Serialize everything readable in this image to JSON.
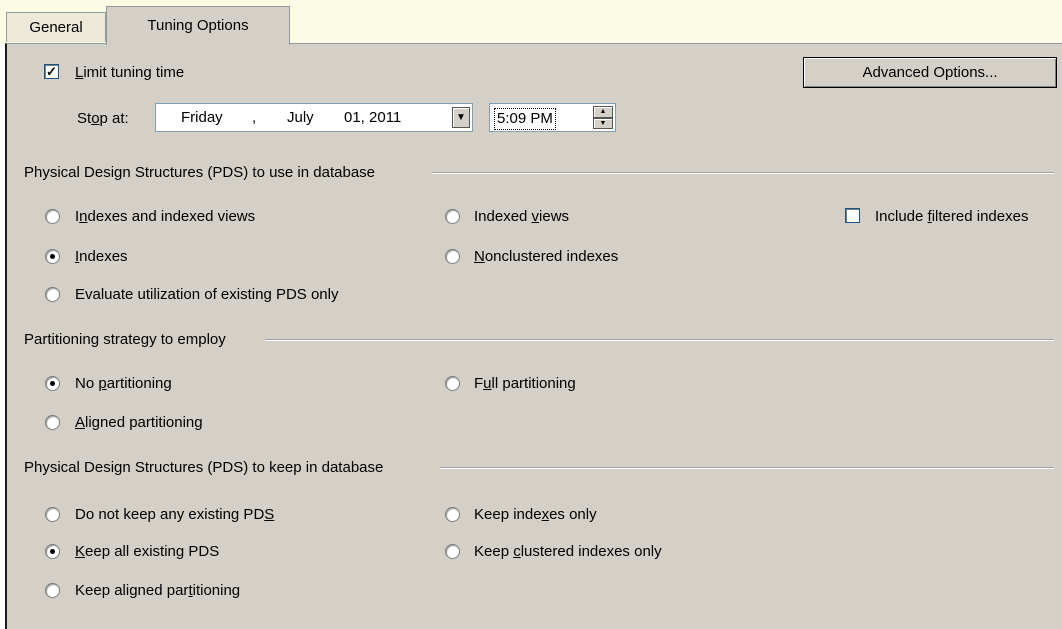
{
  "tabs": {
    "general": "General",
    "tuning": "Tuning Options"
  },
  "limit_time": {
    "checked": true,
    "label": "Limit tuning time"
  },
  "advanced_button": "Advanced Options...",
  "stop_at": {
    "label": "Stop at:",
    "day": "Friday",
    "sep": ",",
    "month": "July",
    "date": "01, 2011",
    "time": "5:09 PM"
  },
  "pds_use": {
    "title": "Physical Design Structures (PDS) to use in database",
    "indexes_and_views": "Indexes and indexed views",
    "indexed_views": "Indexed views",
    "include_filtered": "Include filtered indexes",
    "indexes": "Indexes",
    "nonclustered": "Nonclustered indexes",
    "evaluate": "Evaluate utilization of existing PDS only",
    "selected": "indexes"
  },
  "partitioning": {
    "title": "Partitioning strategy to employ",
    "none": "No partitioning",
    "full": "Full partitioning",
    "aligned": "Aligned partitioning",
    "selected": "none"
  },
  "pds_keep": {
    "title": "Physical Design Structures (PDS) to keep in database",
    "keep_none": "Do not keep any existing PDS",
    "keep_indexes": "Keep indexes only",
    "keep_all": "Keep all existing PDS",
    "keep_clustered": "Keep clustered indexes only",
    "keep_aligned": "Keep aligned partitioning",
    "selected": "keep_all"
  }
}
